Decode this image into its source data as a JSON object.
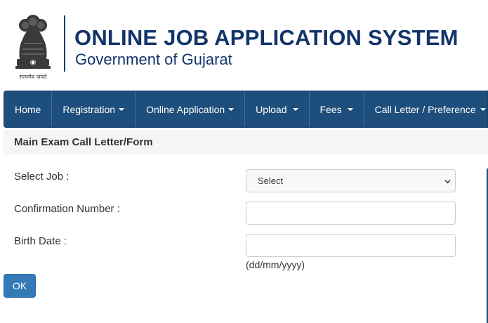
{
  "header": {
    "title": "ONLINE JOB APPLICATION SYSTEM",
    "subtitle": "Government of Gujarat",
    "emblem_motto": "सत्यमेव जयते"
  },
  "nav": {
    "items": [
      {
        "label": "Home",
        "dropdown": false
      },
      {
        "label": "Registration",
        "dropdown": true
      },
      {
        "label": "Online Application",
        "dropdown": true
      },
      {
        "label": "Upload",
        "dropdown": true
      },
      {
        "label": "Fees",
        "dropdown": true
      },
      {
        "label": "Call Letter / Preference",
        "dropdown": true
      }
    ]
  },
  "panel": {
    "heading": "Main Exam Call Letter/Form"
  },
  "form": {
    "select_job_label": "Select Job :",
    "select_job_value": "Select",
    "confirmation_label": "Confirmation Number :",
    "confirmation_value": "",
    "birth_date_label": "Birth Date :",
    "birth_date_value": "",
    "birth_date_hint": "(dd/mm/yyyy)",
    "ok_label": "OK"
  },
  "colors": {
    "brand_navy": "#12346b",
    "nav_bg": "#1d4e7c",
    "button_primary": "#337ab7"
  }
}
